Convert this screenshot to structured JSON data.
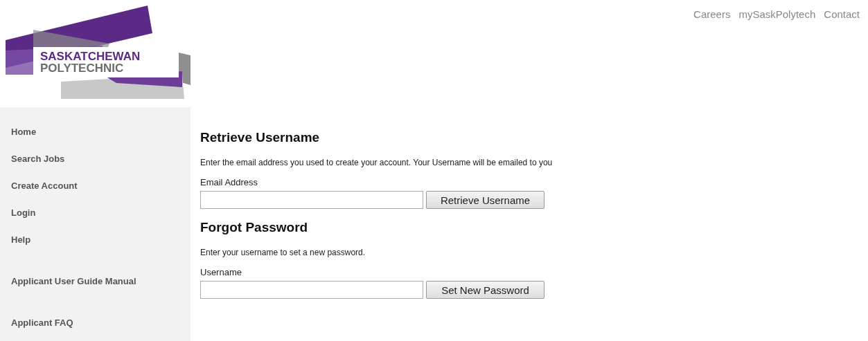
{
  "top_links": [
    "Careers",
    "mySaskPolytech",
    "Contact"
  ],
  "logo": {
    "line1": "SASKATCHEWAN",
    "line2": "POLYTECHNIC"
  },
  "sidebar": {
    "sections": [
      [
        "Home",
        "Search Jobs",
        "Create Account",
        "Login",
        "Help"
      ],
      [
        "Applicant User Guide Manual"
      ],
      [
        "Applicant FAQ"
      ]
    ]
  },
  "forms": [
    {
      "heading": "Retrieve Username",
      "description": "Enter the email address you used to create your account. Your Username will be emailed to you",
      "label": "Email Address",
      "button": "Retrieve Username"
    },
    {
      "heading": "Forgot Password",
      "description": "Enter your username to set a new password.",
      "label": "Username",
      "button": "Set New Password"
    }
  ]
}
